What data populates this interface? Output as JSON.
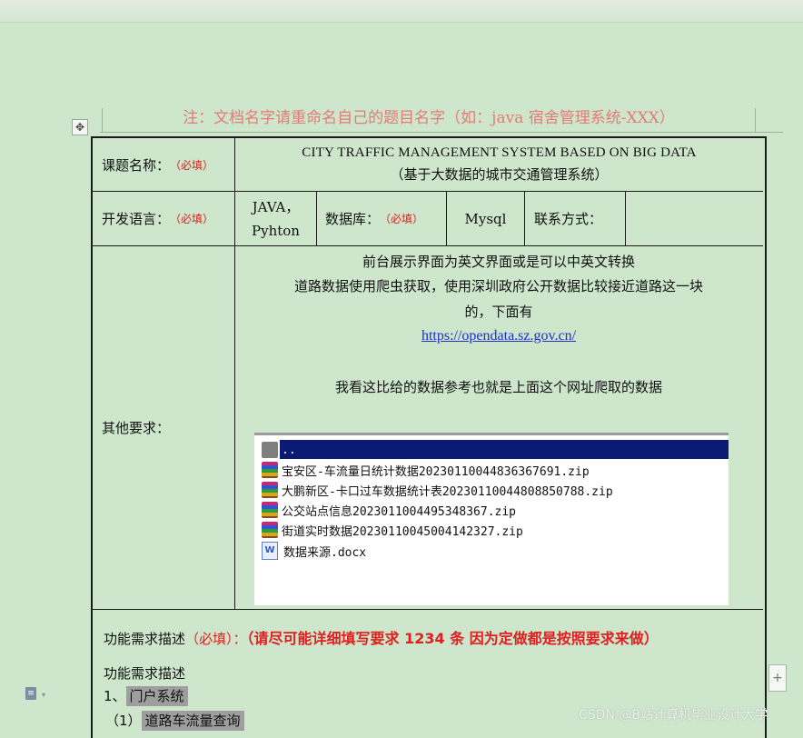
{
  "note": "注：文档名字请重命名自己的题目名字（如：java 宿舍管理系统-XXX）",
  "form": {
    "topic_label": "课题名称：",
    "required_mark": "（必填）",
    "topic_en": "CITY TRAFFIC MANAGEMENT SYSTEM BASED ON BIG DATA",
    "topic_cn": "（基于大数据的城市交通管理系统）",
    "lang_label": "开发语言：",
    "lang_value_line1": "JAVA，",
    "lang_value_line2": "Pyhton",
    "db_label": "数据库：",
    "db_value": "Mysql",
    "contact_label": "联系方式：",
    "other_label": "其他要求：",
    "other_line1": "前台展示界面为英文界面或是可以中英文转换",
    "other_line2": "道路数据使用爬虫获取，使用深圳政府公开数据比较接近道路这一块",
    "other_line3": "的，下面有",
    "other_link": "https://opendata.sz.gov.cn/",
    "other_line4": "我看这比给的数据参考也就是上面这个网址爬取的数据",
    "files": [
      {
        "icon": "folder-icon",
        "name": ".."
      },
      {
        "icon": "zip-icon",
        "name": "宝安区-车流量日统计数据20230110044836367691.zip"
      },
      {
        "icon": "zip-icon",
        "name": "大鹏新区-卡口过车数据统计表20230110044808850788.zip"
      },
      {
        "icon": "zip-icon",
        "name": "公交站点信息20230110044953483​67.zip"
      },
      {
        "icon": "zip-icon",
        "name": "街道实时数据20230110045004142327.zip"
      },
      {
        "icon": "word-icon",
        "name": "数据来源.docx"
      }
    ],
    "func_label": "功能需求描述",
    "func_required": "（必填）：",
    "func_emphasis": "（请尽可能详细填写要求 1234 条 因为定做都是按照要求来做）",
    "func_desc": "功能需求描述",
    "func_item1_num": "1、",
    "func_item1": "门户系统",
    "func_sub1_num": "（1）",
    "func_sub1": "道路车流量查询"
  },
  "watermark": "CSDN @B站计算机毕业设计大学",
  "colors": {
    "background": "#cde6cc",
    "required": "#e02020",
    "link": "#1d2fd0",
    "note": "#e57b76",
    "selection": "#0b1a72"
  }
}
